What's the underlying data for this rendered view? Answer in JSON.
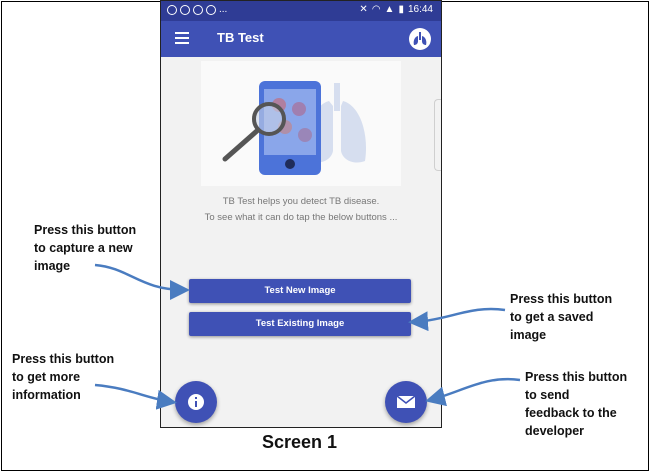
{
  "status_bar": {
    "time": "16:44",
    "overflow": "..."
  },
  "app_bar": {
    "title": "TB Test",
    "menu_icon": "hamburger-menu-icon",
    "action_icon": "lungs-icon"
  },
  "main": {
    "description_line1": "TB Test helps you detect TB disease.",
    "description_line2": "To see what it can do tap the below buttons ...",
    "test_new_image_label": "Test New Image",
    "test_existing_image_label": "Test Existing Image",
    "info_fab_icon": "info-icon",
    "feedback_fab_icon": "envelope-icon"
  },
  "annotations": {
    "capture_line1": "Press this button",
    "capture_line2": "to capture a new",
    "capture_line3": "image",
    "saved_line1": "Press this button",
    "saved_line2": "to get a saved",
    "saved_line3": "image",
    "info_line1": "Press this button",
    "info_line2": "to get more",
    "info_line3": "information",
    "feedback_line1": "Press this button",
    "feedback_line2": "to send",
    "feedback_line3": "feedback to the",
    "feedback_line4": "developer"
  },
  "caption": "Screen 1",
  "colors": {
    "primary": "#3f51b5",
    "status_bar": "#2f3c95",
    "arrow": "#4a7cc0"
  }
}
